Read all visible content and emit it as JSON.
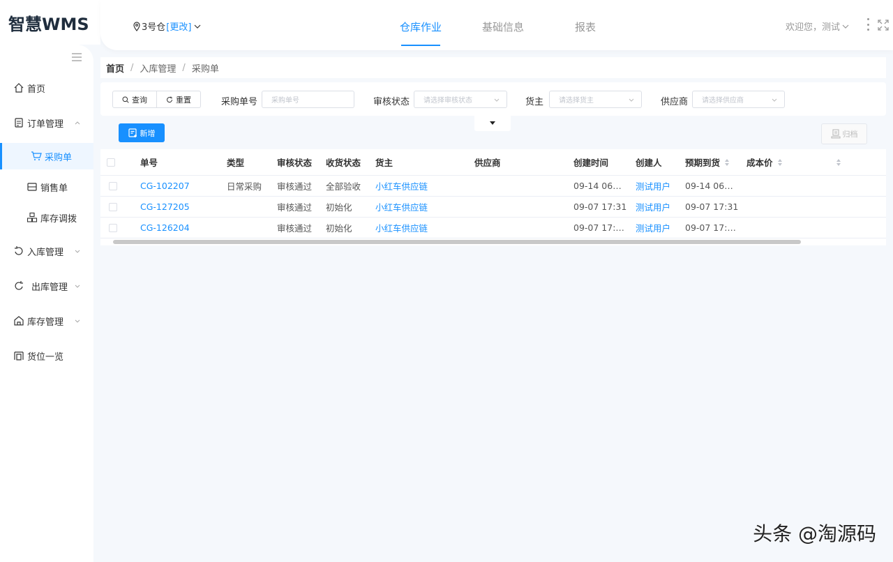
{
  "app": {
    "logo": "智慧WMS"
  },
  "header": {
    "warehouse": "3号仓",
    "change_link": "[更改]",
    "tabs": [
      "仓库作业",
      "基础信息",
      "报表"
    ],
    "user_greeting": "欢迎您，测试"
  },
  "sidebar": {
    "items": [
      {
        "label": "首页",
        "icon": "home-icon"
      },
      {
        "label": "订单管理",
        "icon": "order-icon"
      },
      {
        "label": "采购单",
        "icon": "cart-icon"
      },
      {
        "label": "销售单",
        "icon": "sales-icon"
      },
      {
        "label": "库存调拨",
        "icon": "transfer-icon"
      },
      {
        "label": "入库管理",
        "icon": "inbound-icon"
      },
      {
        "label": "出库管理",
        "icon": "outbound-icon"
      },
      {
        "label": "库存管理",
        "icon": "inventory-icon"
      },
      {
        "label": "货位一览",
        "icon": "location-icon"
      }
    ]
  },
  "breadcrumb": [
    "首页",
    "入库管理",
    "采购单"
  ],
  "filters": {
    "query_label": "查询",
    "reset_label": "重置",
    "order_no_label": "采购单号",
    "order_no_placeholder": "采购单号",
    "status_label": "审核状态",
    "status_placeholder": "请选择审核状态",
    "owner_label": "货主",
    "owner_placeholder": "请选择货主",
    "supplier_label": "供应商",
    "supplier_placeholder": "请选择供应商"
  },
  "toolbar": {
    "add_label": "新增",
    "archive_label": "归档"
  },
  "table": {
    "headers": [
      "单号",
      "类型",
      "审核状态",
      "收货状态",
      "货主",
      "供应商",
      "创建时间",
      "创建人",
      "预期到货",
      "成本价"
    ],
    "rows": [
      [
        "CG-102207",
        "日常采购",
        "审核通过",
        "全部验收",
        "小红车供应链",
        "",
        "09-14 06…",
        "测试用户",
        "09-14 06…",
        ""
      ],
      [
        "CG-127205",
        "",
        "审核通过",
        "初始化",
        "小红车供应链",
        "",
        "09-07 17:31",
        "测试用户",
        "09-07 17:31",
        ""
      ],
      [
        "CG-126204",
        "",
        "审核通过",
        "初始化",
        "小红车供应链",
        "",
        "09-07 17:…",
        "测试用户",
        "09-07 17:…",
        ""
      ]
    ]
  },
  "watermark": "头条 @淘源码",
  "colors": {
    "accent": "#1890ff",
    "background": "#f5f8fc"
  }
}
